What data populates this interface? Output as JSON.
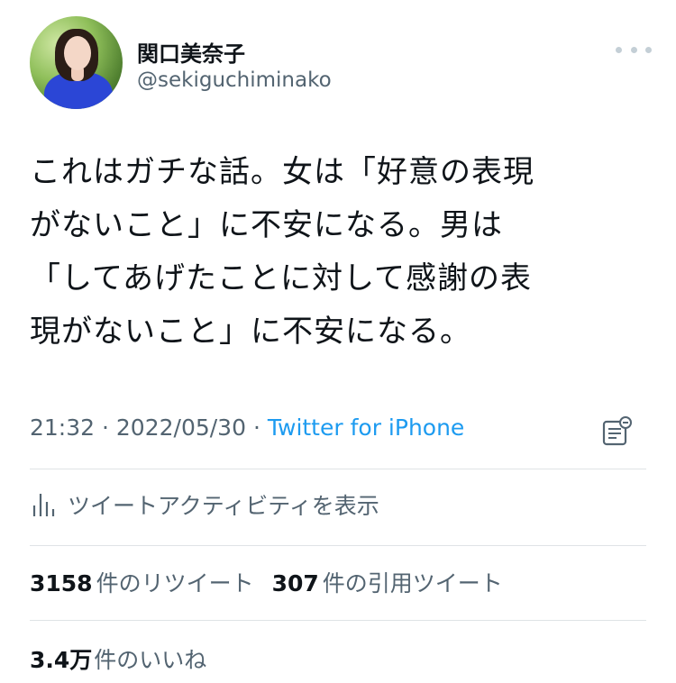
{
  "user": {
    "display_name": "関口美奈子",
    "handle": "@sekiguchiminako"
  },
  "tweet": {
    "lines": [
      "これはガチな話。女は「好意の表現",
      "がないこと」に不安になる。男は",
      "「してあげたことに対して感謝の表",
      "現がないこと」に不安になる。"
    ],
    "time": "21:32",
    "separator": "·",
    "date": "2022/05/30",
    "source": "Twitter for iPhone"
  },
  "activity": {
    "label": "ツイートアクティビティを表示"
  },
  "stats": {
    "retweets_count": "3158",
    "retweets_label": "件のリツイート",
    "quotes_count": "307",
    "quotes_label": "件の引用ツイート",
    "likes_count": "3.4万",
    "likes_label": "件のいいね"
  },
  "colors": {
    "link": "#1d9bf0",
    "secondary": "#536471"
  },
  "icons": {
    "more": "more-horizontal-icon",
    "note": "note-icon",
    "activity": "bar-chart-icon"
  }
}
